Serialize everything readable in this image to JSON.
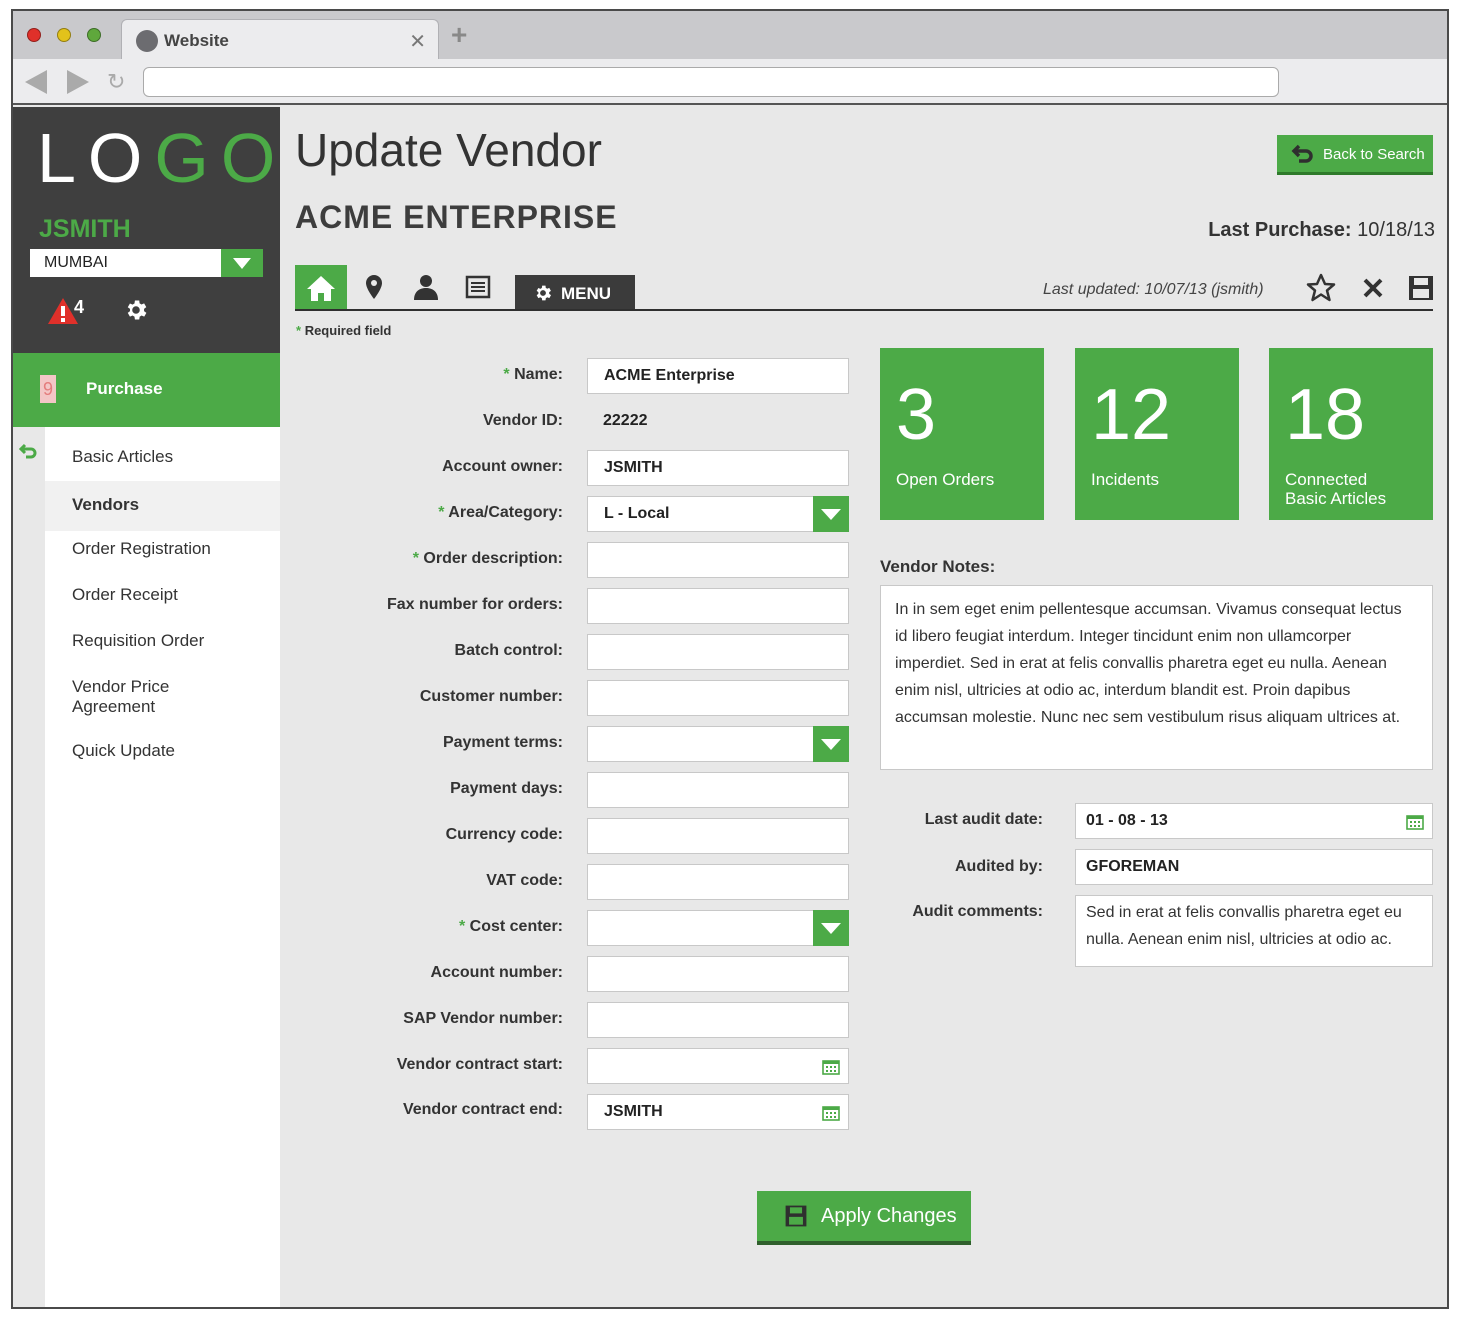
{
  "browser": {
    "tab_title": "Website",
    "tab_close": "✕",
    "new_tab": "+",
    "reload": "↻",
    "url": ""
  },
  "sidebar": {
    "logo_white": "LO",
    "logo_green": "GO",
    "username": "JSMITH",
    "location": "MUMBAI",
    "alert_count": "4",
    "section_label": "Purchase",
    "section_icon_glyph": "9",
    "items": [
      {
        "label": "Basic Articles",
        "active": false
      },
      {
        "label": "Vendors",
        "active": true
      },
      {
        "label": "Order Registration",
        "active": false
      },
      {
        "label": "Order Receipt",
        "active": false
      },
      {
        "label": "Requisition Order",
        "active": false
      },
      {
        "label": "Vendor Price Agreement",
        "active": false
      },
      {
        "label": "Quick Update",
        "active": false
      }
    ],
    "colors": {
      "accent": "#4caa47",
      "dark": "#3f3f3f"
    }
  },
  "header": {
    "title": "Update Vendor",
    "vendor_name": "ACME ENTERPRISE",
    "back_button": "Back to Search",
    "last_purchase_label": "Last Purchase:",
    "last_purchase_value": "10/18/13"
  },
  "toolbar": {
    "icons": [
      "home-icon",
      "location-pin-icon",
      "person-icon",
      "list-icon"
    ],
    "menu_label": "MENU",
    "last_updated": "Last updated: 10/07/13 (jsmith)",
    "right_icons": [
      "star-icon",
      "close-icon",
      "save-icon"
    ]
  },
  "form": {
    "required_note": "Required field",
    "required_mark": "*",
    "fields": {
      "name": {
        "label": "Name:",
        "value": "ACME Enterprise",
        "required": true
      },
      "vendor_id": {
        "label": "Vendor ID:",
        "value": "22222"
      },
      "account_owner": {
        "label": "Account owner:",
        "value": "JSMITH"
      },
      "area_category": {
        "label": "Area/Category:",
        "value": "L - Local",
        "required": true
      },
      "order_description": {
        "label": "Order description:",
        "value": "",
        "required": true
      },
      "fax_number": {
        "label": "Fax number for orders:",
        "value": ""
      },
      "batch_control": {
        "label": "Batch control:",
        "value": ""
      },
      "customer_number": {
        "label": "Customer number:",
        "value": ""
      },
      "payment_terms": {
        "label": "Payment terms:",
        "value": ""
      },
      "payment_days": {
        "label": "Payment days:",
        "value": ""
      },
      "currency_code": {
        "label": "Currency code:",
        "value": ""
      },
      "vat_code": {
        "label": "VAT code:",
        "value": ""
      },
      "cost_center": {
        "label": "Cost center:",
        "value": "",
        "required": true
      },
      "account_number": {
        "label": "Account number:",
        "value": ""
      },
      "sap_vendor_number": {
        "label": "SAP Vendor number:",
        "value": ""
      },
      "contract_start": {
        "label": "Vendor contract start:",
        "value": ""
      },
      "contract_end": {
        "label": "Vendor contract end:",
        "value": "JSMITH"
      }
    }
  },
  "stats": [
    {
      "value": "3",
      "label": "Open Orders"
    },
    {
      "value": "12",
      "label": "Incidents"
    },
    {
      "value": "18",
      "label": "Connected Basic Articles"
    }
  ],
  "notes": {
    "label": "Vendor Notes:",
    "text": "In in sem eget enim pellentesque accumsan. Vivamus consequat lectus id libero feugiat interdum. Integer tincidunt enim non ullamcorper imperdiet. Sed in erat at felis convallis pharetra eget eu nulla. Aenean enim nisl, ultricies at odio ac, interdum blandit est. Proin dapibus accumsan molestie. Nunc nec sem vestibulum risus aliquam ultrices at."
  },
  "audit": {
    "date_label": "Last audit date:",
    "date_value": "01 - 08 - 13",
    "by_label": "Audited by:",
    "by_value": "GFOREMAN",
    "comments_label": "Audit comments:",
    "comments_value": "Sed in erat at felis convallis pharetra eget eu nulla. Aenean enim nisl, ultricies at odio ac."
  },
  "apply_button": "Apply Changes"
}
